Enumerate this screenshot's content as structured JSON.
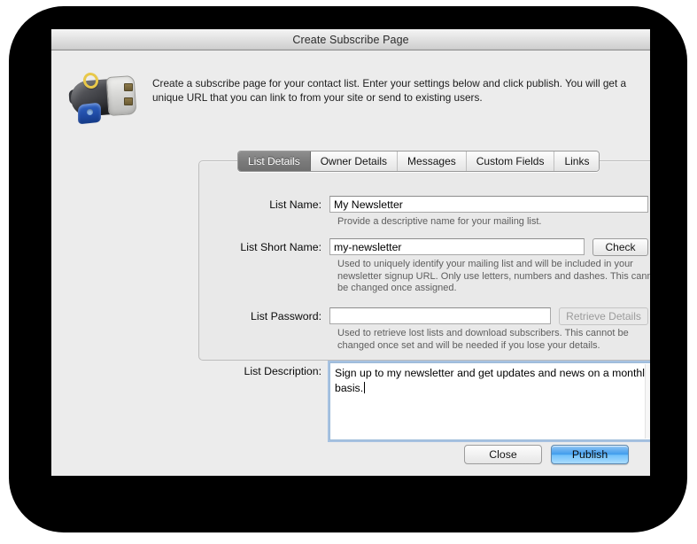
{
  "window": {
    "title": "Create Subscribe Page",
    "icon_name": "subscribe-page-app-icon"
  },
  "header": {
    "description": "Create a subscribe page for your contact list. Enter your settings below and click publish. You will get a unique URL that you can link to from your site or send to existing users."
  },
  "tabs": [
    {
      "label": "List Details",
      "active": true
    },
    {
      "label": "Owner Details",
      "active": false
    },
    {
      "label": "Messages",
      "active": false
    },
    {
      "label": "Custom Fields",
      "active": false
    },
    {
      "label": "Links",
      "active": false
    }
  ],
  "form": {
    "list_name": {
      "label": "List Name:",
      "value": "My Newsletter",
      "placeholder": "",
      "help": "Provide a descriptive name for your mailing list."
    },
    "list_short_name": {
      "label": "List Short Name:",
      "value": "my-newsletter",
      "placeholder": "",
      "button": "Check",
      "help": "Used to uniquely identify your mailing list and will be included in your newsletter signup URL. Only use letters, numbers and dashes. This cannot be changed once assigned."
    },
    "list_password": {
      "label": "List Password:",
      "value": "",
      "placeholder": "",
      "button": "Retrieve Details",
      "button_disabled": true,
      "help": "Used to retrieve lost lists and download subscribers. This cannot be changed once set and will be needed if you lose your details."
    },
    "list_description": {
      "label": "List Description:",
      "value": "Sign up to my newsletter and get updates and news on a monthly basis.",
      "placeholder": ""
    }
  },
  "footer": {
    "close_label": "Close",
    "publish_label": "Publish"
  },
  "colors": {
    "window_bg": "#ececec",
    "panel_bg": "#e9e9e9",
    "accent_default_button": "#3f9ced",
    "focus_ring": "#70a0d8",
    "active_tab": "#7b7b7b",
    "help_text": "#5e5e5e",
    "backdrop": "#000000"
  }
}
